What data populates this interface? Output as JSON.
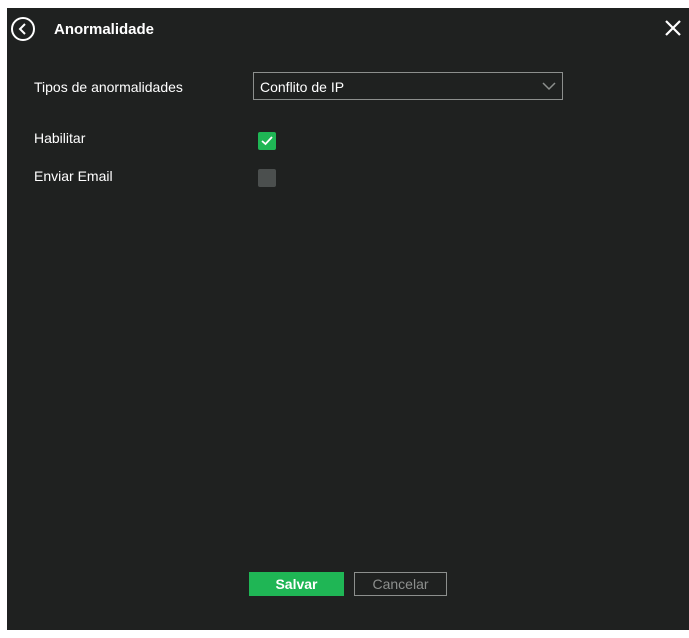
{
  "dialog": {
    "title": "Anormalidade",
    "back_icon": "back-circle-icon",
    "close_icon": "close-icon"
  },
  "form": {
    "type_label": "Tipos de anormalidades",
    "type_value": "Conflito de IP",
    "enable_label": "Habilitar",
    "enable_checked": true,
    "email_label": "Enviar Email",
    "email_checked": false
  },
  "footer": {
    "save_label": "Salvar",
    "cancel_label": "Cancelar"
  },
  "colors": {
    "background": "#1f2120",
    "accent": "#1fb655",
    "border": "#8c8f8d",
    "unchecked": "#4b4f4e"
  }
}
